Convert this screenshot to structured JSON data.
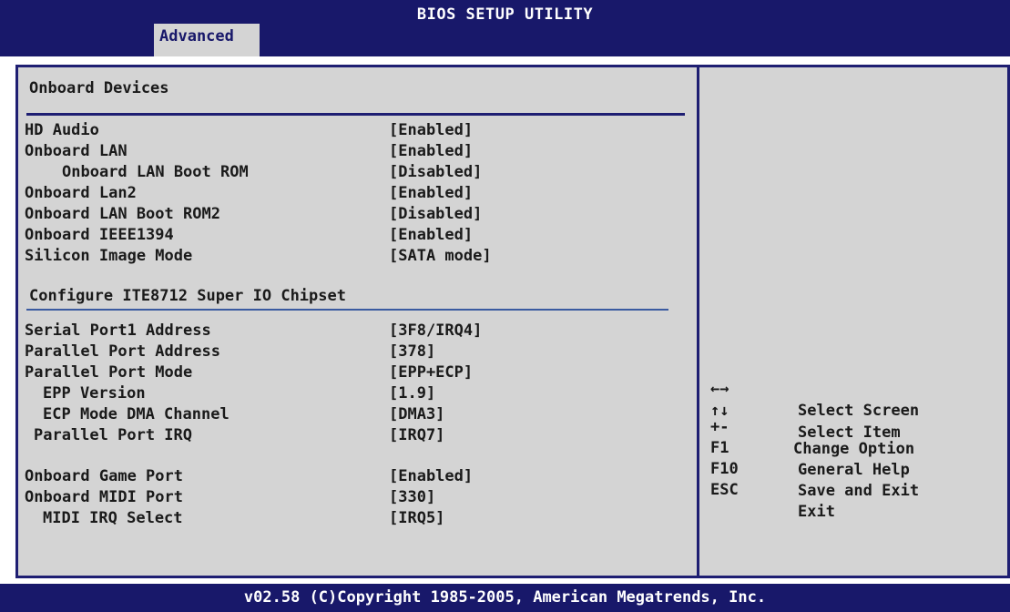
{
  "header": {
    "title": "BIOS SETUP UTILITY",
    "active_tab": "Advanced"
  },
  "section1": {
    "title": "Onboard Devices",
    "items": [
      {
        "label": "HD Audio",
        "value": "[Enabled]"
      },
      {
        "label": "Onboard LAN",
        "value": "[Enabled]"
      },
      {
        "label": "Onboard LAN Boot ROM",
        "value": "[Disabled]"
      },
      {
        "label": "Onboard Lan2",
        "value": "[Enabled]"
      },
      {
        "label": "Onboard LAN Boot ROM2",
        "value": "[Disabled]"
      },
      {
        "label": "Onboard IEEE1394",
        "value": "[Enabled]"
      },
      {
        "label": "Silicon Image Mode",
        "value": "[SATA mode]"
      }
    ]
  },
  "section2": {
    "title": "Configure ITE8712 Super IO Chipset",
    "items": [
      {
        "label": "Serial Port1 Address",
        "value": "[3F8/IRQ4]"
      },
      {
        "label": "Parallel Port Address",
        "value": "[378]"
      },
      {
        "label": "Parallel Port Mode",
        "value": "[EPP+ECP]"
      },
      {
        "label": "EPP Version",
        "value": "[1.9]"
      },
      {
        "label": "ECP Mode DMA Channel",
        "value": "[DMA3]"
      },
      {
        "label": "Parallel Port IRQ",
        "value": "[IRQ7]"
      },
      {
        "label": "Onboard Game Port",
        "value": "[Enabled]"
      },
      {
        "label": "Onboard MIDI Port",
        "value": "[330]"
      },
      {
        "label": "MIDI IRQ Select",
        "value": "[IRQ5]"
      }
    ]
  },
  "help": [
    {
      "key": "←→",
      "desc": "Select Screen"
    },
    {
      "key": "↑↓",
      "desc": "Select Item"
    },
    {
      "key": "+-",
      "desc": "Change Option"
    },
    {
      "key": "F1",
      "desc": "General Help"
    },
    {
      "key": "F10",
      "desc": "Save and Exit"
    },
    {
      "key": "ESC",
      "desc": "Exit"
    }
  ],
  "footer": "v02.58 (C)Copyright 1985-2005, American Megatrends, Inc.",
  "colors": {
    "bar_blue": "#18186a",
    "panel_gray": "#d4d4d4",
    "border_blue": "#1e1e72"
  }
}
